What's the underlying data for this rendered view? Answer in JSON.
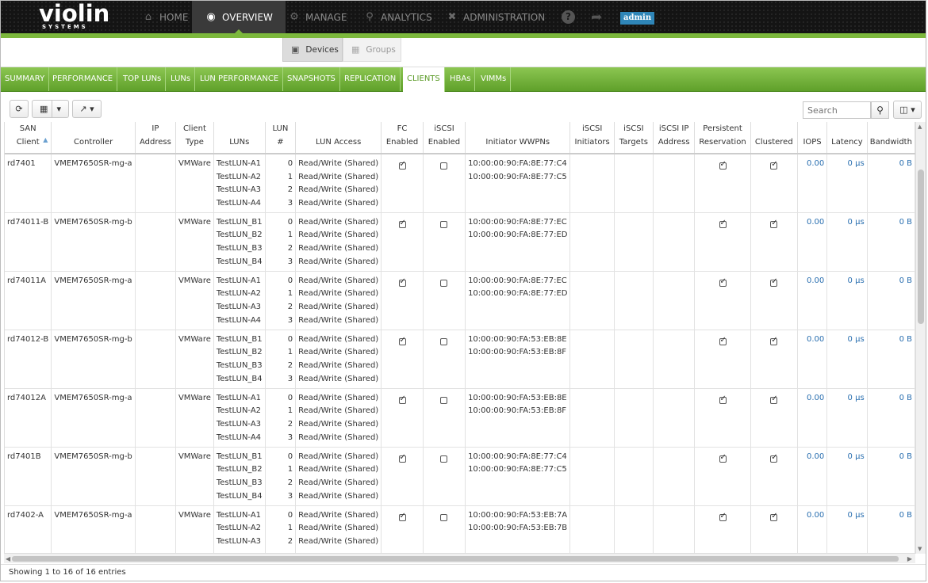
{
  "brand": {
    "name": "violin",
    "tagline": "SYSTEMS"
  },
  "nav": {
    "home": "HOME",
    "overview": "OVERVIEW",
    "manage": "MANAGE",
    "analytics": "ANALYTICS",
    "administration": "ADMINISTRATION",
    "user": "admin"
  },
  "subtabs": {
    "devices": "Devices",
    "groups": "Groups"
  },
  "tabs": [
    "SUMMARY",
    "PERFORMANCE",
    "TOP LUNs",
    "LUNs",
    "LUN PERFORMANCE",
    "SNAPSHOTS",
    "REPLICATION",
    "CLIENTS",
    "HBAs",
    "VIMMs"
  ],
  "active_tab": "CLIENTS",
  "search": {
    "placeholder": "Search"
  },
  "columns": [
    {
      "l1": "SAN",
      "l2": "Client"
    },
    {
      "l1": "",
      "l2": "Controller"
    },
    {
      "l1": "IP",
      "l2": "Address"
    },
    {
      "l1": "Client",
      "l2": "Type"
    },
    {
      "l1": "",
      "l2": "LUNs"
    },
    {
      "l1": "LUN",
      "l2": "#"
    },
    {
      "l1": "",
      "l2": "LUN Access"
    },
    {
      "l1": "FC",
      "l2": "Enabled"
    },
    {
      "l1": "iSCSI",
      "l2": "Enabled"
    },
    {
      "l1": "",
      "l2": "Initiator WWPNs"
    },
    {
      "l1": "iSCSI",
      "l2": "Initiators"
    },
    {
      "l1": "iSCSI",
      "l2": "Targets"
    },
    {
      "l1": "iSCSI IP",
      "l2": "Address"
    },
    {
      "l1": "Persistent",
      "l2": "Reservation"
    },
    {
      "l1": "",
      "l2": "Clustered"
    },
    {
      "l1": "",
      "l2": "IOPS"
    },
    {
      "l1": "",
      "l2": "Latency"
    },
    {
      "l1": "",
      "l2": "Bandwidth"
    }
  ],
  "rows": [
    {
      "client": "rd7401",
      "controller": "VMEM7650SR-mg-a",
      "ip": "",
      "type": "VMWare",
      "luns": [
        "TestLUN-A1",
        "TestLUN-A2",
        "TestLUN-A3",
        "TestLUN-A4"
      ],
      "lun_nums": [
        "0",
        "1",
        "2",
        "3"
      ],
      "access": [
        "Read/Write (Shared)",
        "Read/Write (Shared)",
        "Read/Write (Shared)",
        "Read/Write (Shared)"
      ],
      "fc": true,
      "iscsi": false,
      "wwpns": [
        "10:00:00:90:FA:8E:77:C4",
        "10:00:00:90:FA:8E:77:C5"
      ],
      "persistent": true,
      "clustered": true,
      "iops": "0.00",
      "latency": "0 µs",
      "bandwidth": "0 B"
    },
    {
      "client": "rd74011-B",
      "controller": "VMEM7650SR-mg-b",
      "ip": "",
      "type": "VMWare",
      "luns": [
        "TestLUN_B1",
        "TestLUN_B2",
        "TestLUN_B3",
        "TestLUN_B4"
      ],
      "lun_nums": [
        "0",
        "1",
        "2",
        "3"
      ],
      "access": [
        "Read/Write (Shared)",
        "Read/Write (Shared)",
        "Read/Write (Shared)",
        "Read/Write (Shared)"
      ],
      "fc": true,
      "iscsi": false,
      "wwpns": [
        "10:00:00:90:FA:8E:77:EC",
        "10:00:00:90:FA:8E:77:ED"
      ],
      "persistent": true,
      "clustered": true,
      "iops": "0.00",
      "latency": "0 µs",
      "bandwidth": "0 B"
    },
    {
      "client": "rd74011A",
      "controller": "VMEM7650SR-mg-a",
      "ip": "",
      "type": "VMWare",
      "luns": [
        "TestLUN-A1",
        "TestLUN-A2",
        "TestLUN-A3",
        "TestLUN-A4"
      ],
      "lun_nums": [
        "0",
        "1",
        "2",
        "3"
      ],
      "access": [
        "Read/Write (Shared)",
        "Read/Write (Shared)",
        "Read/Write (Shared)",
        "Read/Write (Shared)"
      ],
      "fc": true,
      "iscsi": false,
      "wwpns": [
        "10:00:00:90:FA:8E:77:EC",
        "10:00:00:90:FA:8E:77:ED"
      ],
      "persistent": true,
      "clustered": true,
      "iops": "0.00",
      "latency": "0 µs",
      "bandwidth": "0 B"
    },
    {
      "client": "rd74012-B",
      "controller": "VMEM7650SR-mg-b",
      "ip": "",
      "type": "VMWare",
      "luns": [
        "TestLUN_B1",
        "TestLUN_B2",
        "TestLUN_B3",
        "TestLUN_B4"
      ],
      "lun_nums": [
        "0",
        "1",
        "2",
        "3"
      ],
      "access": [
        "Read/Write (Shared)",
        "Read/Write (Shared)",
        "Read/Write (Shared)",
        "Read/Write (Shared)"
      ],
      "fc": true,
      "iscsi": false,
      "wwpns": [
        "10:00:00:90:FA:53:EB:8E",
        "10:00:00:90:FA:53:EB:8F"
      ],
      "persistent": true,
      "clustered": true,
      "iops": "0.00",
      "latency": "0 µs",
      "bandwidth": "0 B"
    },
    {
      "client": "rd74012A",
      "controller": "VMEM7650SR-mg-a",
      "ip": "",
      "type": "VMWare",
      "luns": [
        "TestLUN-A1",
        "TestLUN-A2",
        "TestLUN-A3",
        "TestLUN-A4"
      ],
      "lun_nums": [
        "0",
        "1",
        "2",
        "3"
      ],
      "access": [
        "Read/Write (Shared)",
        "Read/Write (Shared)",
        "Read/Write (Shared)",
        "Read/Write (Shared)"
      ],
      "fc": true,
      "iscsi": false,
      "wwpns": [
        "10:00:00:90:FA:53:EB:8E",
        "10:00:00:90:FA:53:EB:8F"
      ],
      "persistent": true,
      "clustered": true,
      "iops": "0.00",
      "latency": "0 µs",
      "bandwidth": "0 B"
    },
    {
      "client": "rd7401B",
      "controller": "VMEM7650SR-mg-b",
      "ip": "",
      "type": "VMWare",
      "luns": [
        "TestLUN_B1",
        "TestLUN_B2",
        "TestLUN_B3",
        "TestLUN_B4"
      ],
      "lun_nums": [
        "0",
        "1",
        "2",
        "3"
      ],
      "access": [
        "Read/Write (Shared)",
        "Read/Write (Shared)",
        "Read/Write (Shared)",
        "Read/Write (Shared)"
      ],
      "fc": true,
      "iscsi": false,
      "wwpns": [
        "10:00:00:90:FA:8E:77:C4",
        "10:00:00:90:FA:8E:77:C5"
      ],
      "persistent": true,
      "clustered": true,
      "iops": "0.00",
      "latency": "0 µs",
      "bandwidth": "0 B"
    },
    {
      "client": "rd7402-A",
      "controller": "VMEM7650SR-mg-a",
      "ip": "",
      "type": "VMWare",
      "luns": [
        "TestLUN-A1",
        "TestLUN-A2",
        "TestLUN-A3"
      ],
      "lun_nums": [
        "0",
        "1",
        "2"
      ],
      "access": [
        "Read/Write (Shared)",
        "Read/Write (Shared)",
        "Read/Write (Shared)"
      ],
      "fc": true,
      "iscsi": false,
      "wwpns": [
        "10:00:00:90:FA:53:EB:7A",
        "10:00:00:90:FA:53:EB:7B"
      ],
      "persistent": true,
      "clustered": true,
      "iops": "0.00",
      "latency": "0 µs",
      "bandwidth": "0 B"
    }
  ],
  "footer": {
    "text": "Showing 1 to 16 of 16 entries"
  },
  "colors": {
    "accent": "#7cb83c",
    "nav_bg": "#141414",
    "link": "#2a6fb0",
    "admin_badge": "#2f86b8"
  },
  "icons": {
    "home": "home-icon",
    "overview": "eye-icon",
    "manage": "gear-icon",
    "analytics": "search-icon",
    "administration": "wrench-icon",
    "refresh": "refresh-icon",
    "save": "save-icon",
    "export": "export-icon",
    "columns": "columns-icon"
  }
}
